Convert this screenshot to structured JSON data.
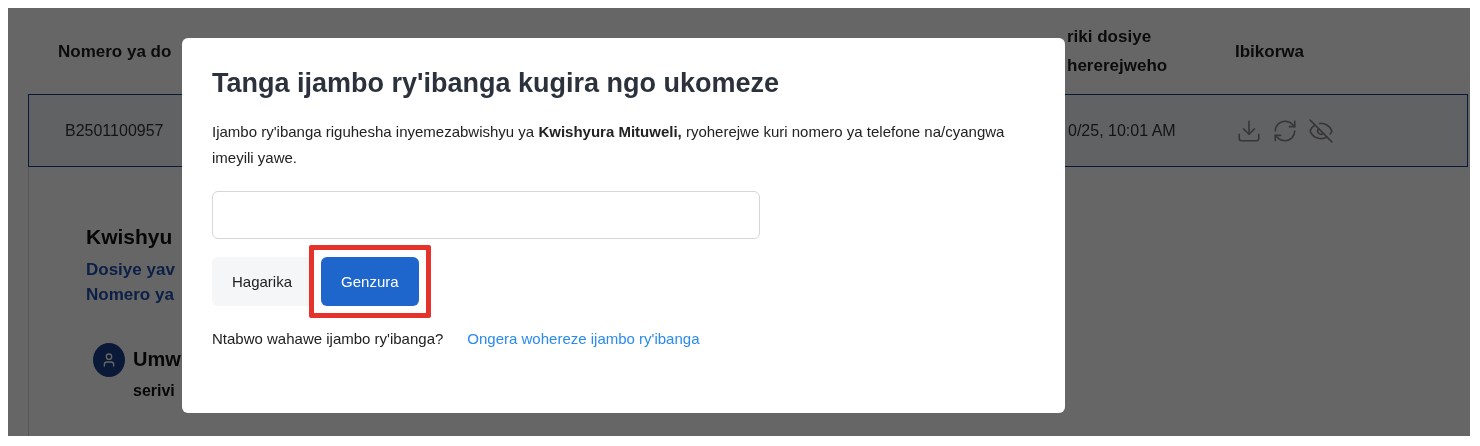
{
  "background": {
    "table": {
      "columns": [
        {
          "lines": [
            "Nomero ya do"
          ]
        },
        {
          "lines": [
            "riki dosiye",
            "hererejweho"
          ]
        },
        {
          "lines": [
            "Ibikorwa"
          ]
        }
      ],
      "rows": [
        {
          "cells": [
            "B2501100957",
            "0/25, 10:01 AM"
          ]
        }
      ]
    },
    "detail": {
      "title": "Kwishyu",
      "links": [
        "Dosiye yav",
        "Nomero ya"
      ],
      "person_lines": [
        "Umw",
        "serivi"
      ]
    }
  },
  "modal": {
    "title": "Tanga ijambo ry'ibanga kugira ngo ukomeze",
    "message": "Ijambo ry'ibanga riguhesha inyemezabwishyu ya **Kwishyura Mituweli,** ryoherejwe kuri nomero ya telefone na/cyangwa imeyili yawe.",
    "buttons": [
      {
        "label": "Hagarika",
        "kind": "secondary",
        "highlighted": false
      },
      {
        "label": "Genzura",
        "kind": "primary",
        "highlighted": true
      }
    ],
    "footer": {
      "prompt": "Ntabwo wahawe ijambo ry'ibanga?",
      "link": "Ongera wohereze ijambo ry'ibanga"
    }
  }
}
